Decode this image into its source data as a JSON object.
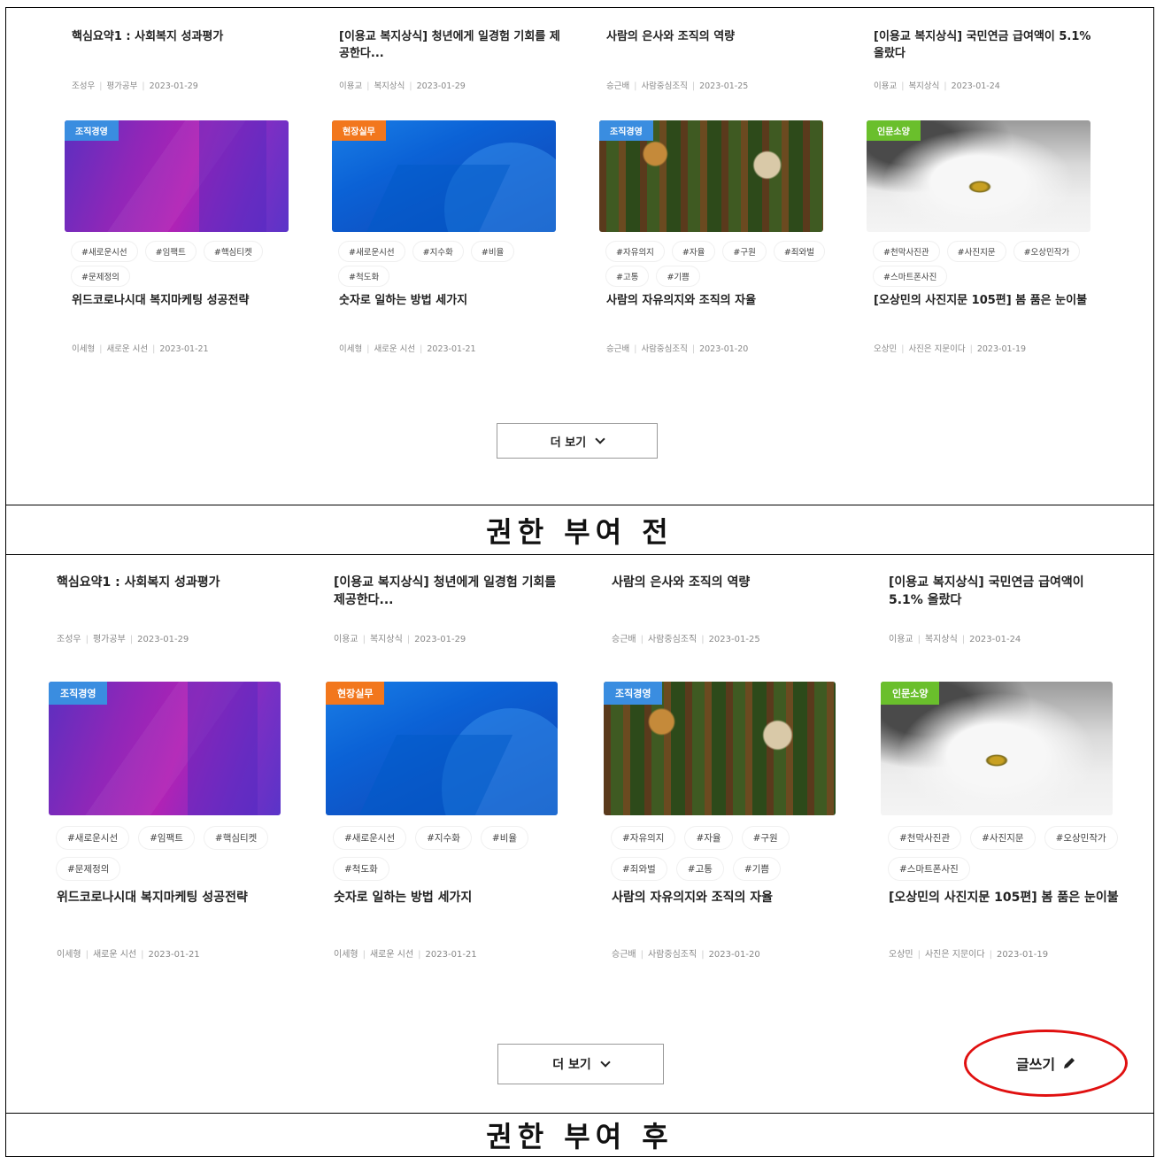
{
  "sections": [
    {
      "caption": "권한 부여 전",
      "more_label": "더 보기",
      "top_posts": [
        {
          "title": "핵심요약1 : 사회복지 성과평가",
          "author": "조성우",
          "category": "평가공부",
          "date": "2023-01-29"
        },
        {
          "title": "[이용교 복지상식] 청년에게 일경험 기회를 제공한다...",
          "author": "이용교",
          "category": "복지상식",
          "date": "2023-01-29"
        },
        {
          "title": "사람의 은사와 조직의 역량",
          "author": "승근배",
          "category": "사람중심조직",
          "date": "2023-01-25"
        },
        {
          "title": "[이용교 복지상식] 국민연금 급여액이 5.1% 올랐다",
          "author": "이용교",
          "category": "복지상식",
          "date": "2023-01-24"
        }
      ],
      "cards": [
        {
          "badge": "조직경영",
          "tags": [
            "#새로운시선",
            "#임팩트",
            "#핵심티켓",
            "#문제정의"
          ],
          "title": "위드코로나시대 복지마케팅 성공전략",
          "author": "이세형",
          "category": "새로운 시선",
          "date": "2023-01-21"
        },
        {
          "badge": "현장실무",
          "tags": [
            "#새로운시선",
            "#지수화",
            "#비율",
            "#척도화"
          ],
          "title": "숫자로 일하는 방법 세가지",
          "author": "이세형",
          "category": "새로운 시선",
          "date": "2023-01-21"
        },
        {
          "badge": "조직경영",
          "tags": [
            "#자유의지",
            "#자율",
            "#구원",
            "#죄와벌",
            "#고통",
            "#기쁨"
          ],
          "title": "사람의 자유의지와 조직의 자율",
          "author": "승근배",
          "category": "사람중심조직",
          "date": "2023-01-20"
        },
        {
          "badge": "인문소양",
          "tags": [
            "#천막사진관",
            "#사진지문",
            "#오상민작가",
            "#스마트폰사진"
          ],
          "title": "[오상민의 사진지문 105편] 봄 품은 눈이불",
          "author": "오상민",
          "category": "사진은 지문이다",
          "date": "2023-01-19"
        }
      ]
    },
    {
      "caption": "권한 부여 후",
      "more_label": "더 보기",
      "write_label": "글쓰기",
      "top_posts": [
        {
          "title": "핵심요약1 : 사회복지 성과평가",
          "author": "조성우",
          "category": "평가공부",
          "date": "2023-01-29"
        },
        {
          "title": "[이용교 복지상식] 청년에게 일경험 기회를 제공한다...",
          "author": "이용교",
          "category": "복지상식",
          "date": "2023-01-29"
        },
        {
          "title": "사람의 은사와 조직의 역량",
          "author": "승근배",
          "category": "사람중심조직",
          "date": "2023-01-25"
        },
        {
          "title": "[이용교 복지상식] 국민연금 급여액이 5.1% 올랐다",
          "author": "이용교",
          "category": "복지상식",
          "date": "2023-01-24"
        }
      ],
      "cards": [
        {
          "badge": "조직경영",
          "tags": [
            "#새로운시선",
            "#임팩트",
            "#핵심티켓",
            "#문제정의"
          ],
          "title": "위드코로나시대 복지마케팅 성공전략",
          "author": "이세형",
          "category": "새로운 시선",
          "date": "2023-01-21"
        },
        {
          "badge": "현장실무",
          "tags": [
            "#새로운시선",
            "#지수화",
            "#비율",
            "#척도화"
          ],
          "title": "숫자로 일하는 방법 세가지",
          "author": "이세형",
          "category": "새로운 시선",
          "date": "2023-01-21"
        },
        {
          "badge": "조직경영",
          "tags": [
            "#자유의지",
            "#자율",
            "#구원",
            "#죄와벌",
            "#고통",
            "#기쁨"
          ],
          "title": "사람의 자유의지와 조직의 자율",
          "author": "승근배",
          "category": "사람중심조직",
          "date": "2023-01-20"
        },
        {
          "badge": "인문소양",
          "tags": [
            "#천막사진관",
            "#사진지문",
            "#오상민작가",
            "#스마트폰사진"
          ],
          "title": "[오상민의 사진지문 105편] 봄 품은 눈이불",
          "author": "오상민",
          "category": "사진은 지문이다",
          "date": "2023-01-19"
        }
      ]
    }
  ],
  "colors": {
    "badge_blue": "#3a8de0",
    "badge_orange": "#f2771d",
    "badge_green": "#6abf2c",
    "highlight": "#e01010"
  },
  "icons": {
    "more_chevron": "chevron-down-icon",
    "write_pencil": "pencil-icon"
  }
}
